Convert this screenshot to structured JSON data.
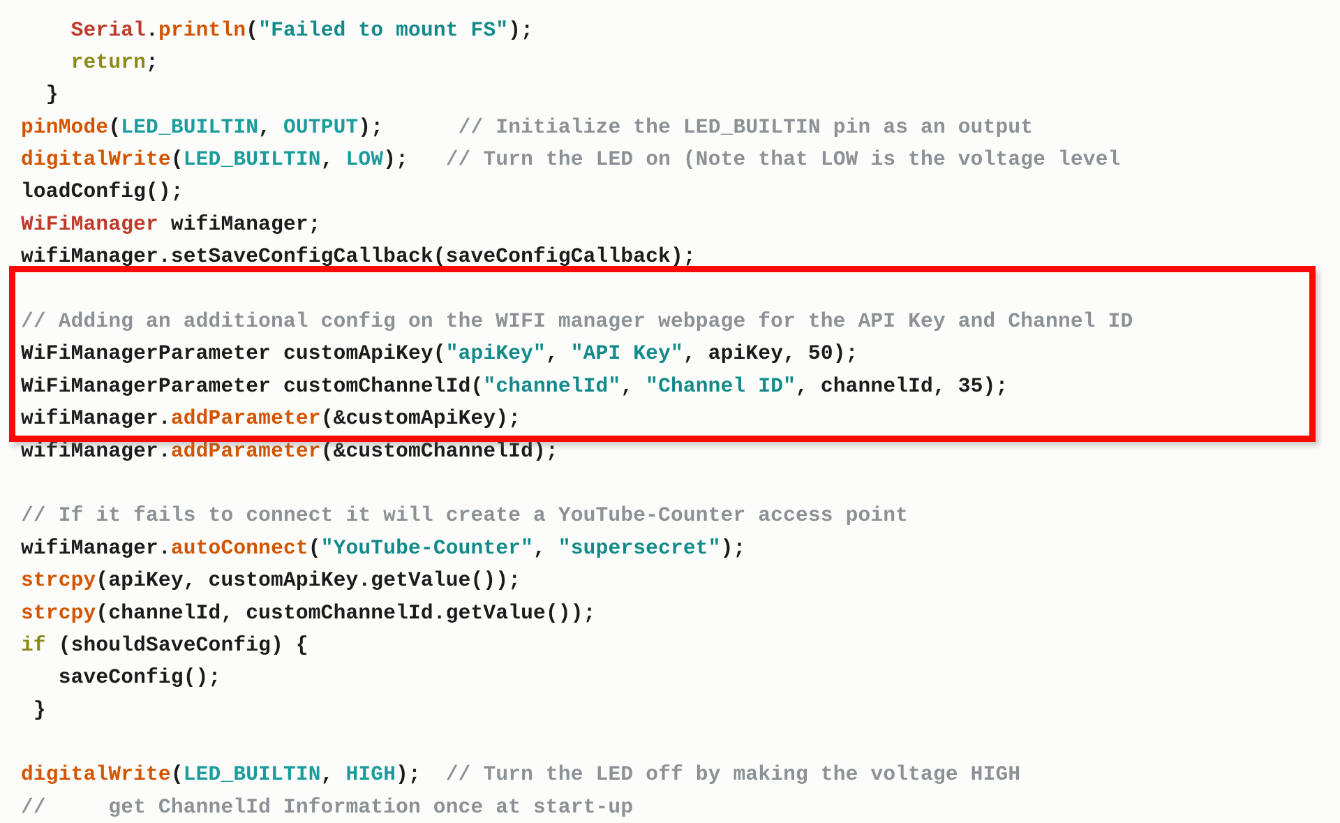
{
  "document": {
    "kind": "source-code-listing",
    "language": "C++ / Arduino",
    "background_color": "#fcfdfa",
    "default_text_color": "#1b1b1b"
  },
  "annotation": {
    "type": "rectangle-highlight",
    "color": "#fb0a05",
    "border_width_px": 9,
    "covers_lines": [
      9,
      10,
      11,
      12,
      13
    ],
    "label": "highlighted-code-region"
  },
  "palette": {
    "function": "#d35400",
    "type_name": "#c0392b",
    "constant": "#1a9c9c",
    "string": "#128a8a",
    "keyword": "#8a8a18",
    "comment": "#8c9196",
    "plain": "#1b1b1b",
    "highlight": "#fb0a05"
  },
  "code": {
    "lines": [
      {
        "id": "line-1",
        "clipped": "top",
        "tokens": [
          {
            "t": "plain",
            "s": "    "
          },
          {
            "t": "type",
            "s": "Serial"
          },
          {
            "t": "plain",
            "s": "."
          },
          {
            "t": "fn",
            "s": "println"
          },
          {
            "t": "plain",
            "s": "("
          },
          {
            "t": "string",
            "s": "\"Failed to mount FS\""
          },
          {
            "t": "plain",
            "s": ");"
          }
        ]
      },
      {
        "id": "line-2",
        "tokens": [
          {
            "t": "plain",
            "s": "    "
          },
          {
            "t": "keyword",
            "s": "return"
          },
          {
            "t": "plain",
            "s": ";"
          }
        ]
      },
      {
        "id": "line-3",
        "tokens": [
          {
            "t": "plain",
            "s": "  }"
          }
        ]
      },
      {
        "id": "line-4",
        "tokens": [
          {
            "t": "fn",
            "s": "pinMode"
          },
          {
            "t": "plain",
            "s": "("
          },
          {
            "t": "const",
            "s": "LED_BUILTIN"
          },
          {
            "t": "plain",
            "s": ", "
          },
          {
            "t": "const",
            "s": "OUTPUT"
          },
          {
            "t": "plain",
            "s": ");"
          },
          {
            "t": "plain",
            "s": "      "
          },
          {
            "t": "comment",
            "s": "// Initialize the LED_BUILTIN pin as an output"
          }
        ]
      },
      {
        "id": "line-5",
        "tokens": [
          {
            "t": "fn",
            "s": "digitalWrite"
          },
          {
            "t": "plain",
            "s": "("
          },
          {
            "t": "const",
            "s": "LED_BUILTIN"
          },
          {
            "t": "plain",
            "s": ", "
          },
          {
            "t": "const",
            "s": "LOW"
          },
          {
            "t": "plain",
            "s": ");"
          },
          {
            "t": "plain",
            "s": "   "
          },
          {
            "t": "comment",
            "s": "// Turn the LED on (Note that LOW is the voltage level"
          }
        ]
      },
      {
        "id": "line-6",
        "tokens": [
          {
            "t": "plain",
            "s": "loadConfig();"
          }
        ]
      },
      {
        "id": "line-7",
        "tokens": [
          {
            "t": "type",
            "s": "WiFiManager"
          },
          {
            "t": "plain",
            "s": " wifiManager;"
          }
        ]
      },
      {
        "id": "line-8",
        "tokens": [
          {
            "t": "plain",
            "s": "wifiManager.setSaveConfigCallback(saveConfigCallback);"
          }
        ]
      },
      {
        "id": "line-9-blank",
        "tokens": [
          {
            "t": "plain",
            "s": ""
          }
        ]
      },
      {
        "id": "line-10",
        "highlighted": true,
        "tokens": [
          {
            "t": "comment",
            "s": "// Adding an additional config on the WIFI manager webpage for the API Key and Channel ID"
          }
        ]
      },
      {
        "id": "line-11",
        "highlighted": true,
        "tokens": [
          {
            "t": "plain",
            "s": "WiFiManagerParameter customApiKey("
          },
          {
            "t": "string",
            "s": "\"apiKey\""
          },
          {
            "t": "plain",
            "s": ", "
          },
          {
            "t": "string",
            "s": "\"API Key\""
          },
          {
            "t": "plain",
            "s": ", apiKey, "
          },
          {
            "t": "num",
            "s": "50"
          },
          {
            "t": "plain",
            "s": ");"
          }
        ]
      },
      {
        "id": "line-12",
        "highlighted": true,
        "tokens": [
          {
            "t": "plain",
            "s": "WiFiManagerParameter customChannelId("
          },
          {
            "t": "string",
            "s": "\"channelId\""
          },
          {
            "t": "plain",
            "s": ", "
          },
          {
            "t": "string",
            "s": "\"Channel ID\""
          },
          {
            "t": "plain",
            "s": ", channelId, "
          },
          {
            "t": "num",
            "s": "35"
          },
          {
            "t": "plain",
            "s": ");"
          }
        ]
      },
      {
        "id": "line-13",
        "highlighted": true,
        "tokens": [
          {
            "t": "plain",
            "s": "wifiManager."
          },
          {
            "t": "fn",
            "s": "addParameter"
          },
          {
            "t": "plain",
            "s": "(&customApiKey);"
          }
        ]
      },
      {
        "id": "line-14",
        "highlighted": true,
        "tokens": [
          {
            "t": "plain",
            "s": "wifiManager."
          },
          {
            "t": "fn",
            "s": "addParameter"
          },
          {
            "t": "plain",
            "s": "(&customChannelId);"
          }
        ]
      },
      {
        "id": "line-15-blank",
        "tokens": [
          {
            "t": "plain",
            "s": ""
          }
        ]
      },
      {
        "id": "line-16",
        "tokens": [
          {
            "t": "comment",
            "s": "// If it fails to connect it will create a YouTube-Counter access point"
          }
        ]
      },
      {
        "id": "line-17",
        "tokens": [
          {
            "t": "plain",
            "s": "wifiManager."
          },
          {
            "t": "fn",
            "s": "autoConnect"
          },
          {
            "t": "plain",
            "s": "("
          },
          {
            "t": "string",
            "s": "\"YouTube-Counter\""
          },
          {
            "t": "plain",
            "s": ", "
          },
          {
            "t": "string",
            "s": "\"supersecret\""
          },
          {
            "t": "plain",
            "s": ");"
          }
        ]
      },
      {
        "id": "line-18",
        "tokens": [
          {
            "t": "fn",
            "s": "strcpy"
          },
          {
            "t": "plain",
            "s": "(apiKey, customApiKey.getValue());"
          }
        ]
      },
      {
        "id": "line-19",
        "tokens": [
          {
            "t": "fn",
            "s": "strcpy"
          },
          {
            "t": "plain",
            "s": "(channelId, customChannelId.getValue());"
          }
        ]
      },
      {
        "id": "line-20",
        "tokens": [
          {
            "t": "keyword",
            "s": "if"
          },
          {
            "t": "plain",
            "s": " (shouldSaveConfig) {"
          }
        ]
      },
      {
        "id": "line-21",
        "tokens": [
          {
            "t": "plain",
            "s": "   saveConfig();"
          }
        ]
      },
      {
        "id": "line-22",
        "tokens": [
          {
            "t": "plain",
            "s": " }"
          }
        ]
      },
      {
        "id": "line-23-blank",
        "tokens": [
          {
            "t": "plain",
            "s": ""
          }
        ]
      },
      {
        "id": "line-24",
        "tokens": [
          {
            "t": "fn",
            "s": "digitalWrite"
          },
          {
            "t": "plain",
            "s": "("
          },
          {
            "t": "const",
            "s": "LED_BUILTIN"
          },
          {
            "t": "plain",
            "s": ", "
          },
          {
            "t": "const",
            "s": "HIGH"
          },
          {
            "t": "plain",
            "s": ");"
          },
          {
            "t": "plain",
            "s": "  "
          },
          {
            "t": "comment",
            "s": "// Turn the LED off by making the voltage HIGH"
          }
        ]
      },
      {
        "id": "line-25",
        "clipped": "bottom",
        "tokens": [
          {
            "t": "comment",
            "s": "//     get ChannelId Information once at start-up"
          }
        ]
      }
    ]
  }
}
